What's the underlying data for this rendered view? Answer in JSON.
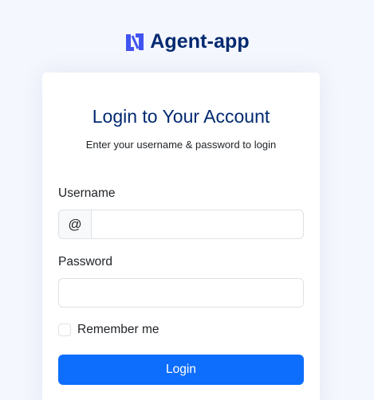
{
  "brand": {
    "name": "Agent-app",
    "logo_icon": "agent-app-logo-icon",
    "color": "#012970",
    "logo_color": "#4154f1"
  },
  "login": {
    "title": "Login to Your Account",
    "subtitle": "Enter your username & password to login",
    "username_label": "Username",
    "username_prefix": "@",
    "username_value": "",
    "password_label": "Password",
    "password_value": "",
    "remember_label": "Remember me",
    "remember_checked": false,
    "button_label": "Login",
    "button_color": "#0d6efd"
  }
}
